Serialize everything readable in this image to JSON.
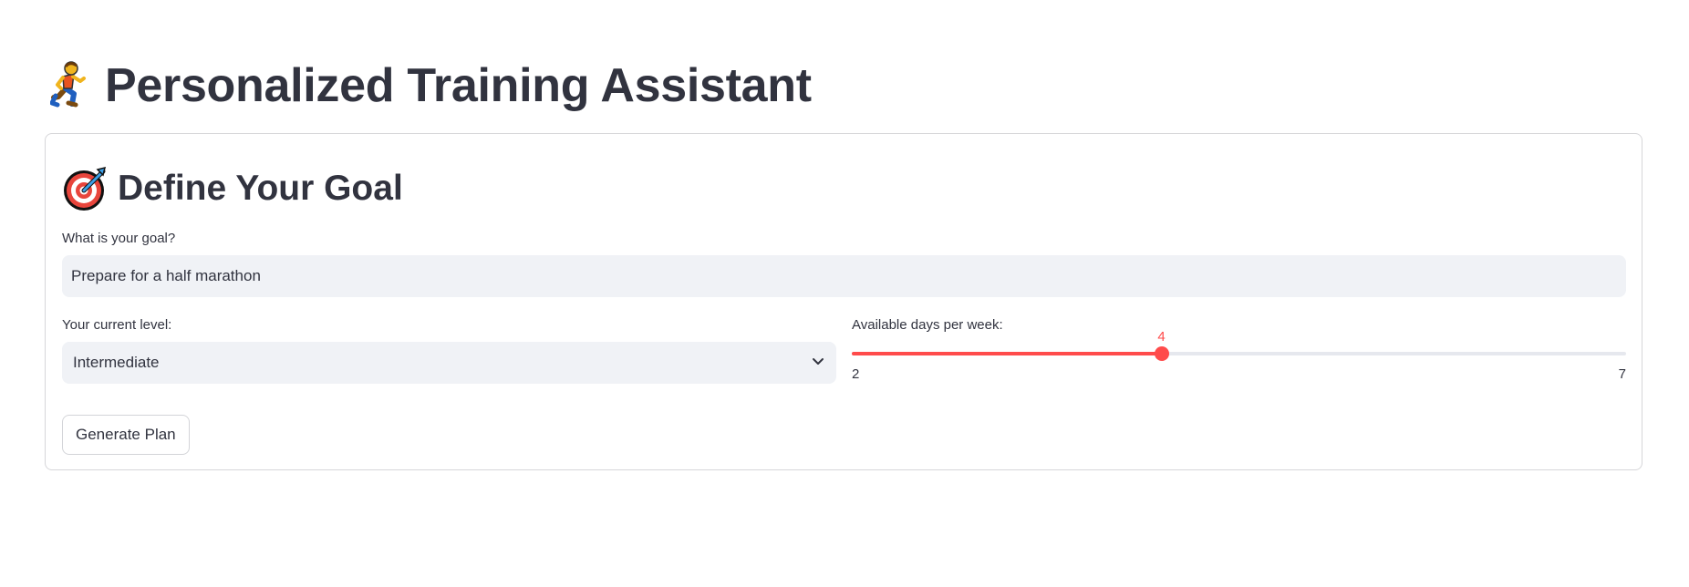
{
  "page": {
    "title": "Personalized Training Assistant",
    "title_icon": "runner-icon"
  },
  "goal_section": {
    "title": "Define Your Goal",
    "icon": "target-icon",
    "goal_field": {
      "label": "What is your goal?",
      "value": "Prepare for a half marathon"
    },
    "level_field": {
      "label": "Your current level:",
      "selected": "Intermediate",
      "icon": "chevron-down-icon"
    },
    "days_slider": {
      "label": "Available days per week:",
      "min": 2,
      "max": 7,
      "value": 4,
      "min_label": "2",
      "max_label": "7",
      "value_label": "4"
    },
    "generate_button": "Generate Plan"
  },
  "colors": {
    "accent": "#ff4b4b",
    "text": "#31333f",
    "input_bg": "#f0f2f6",
    "border": "#d6d6d9"
  }
}
